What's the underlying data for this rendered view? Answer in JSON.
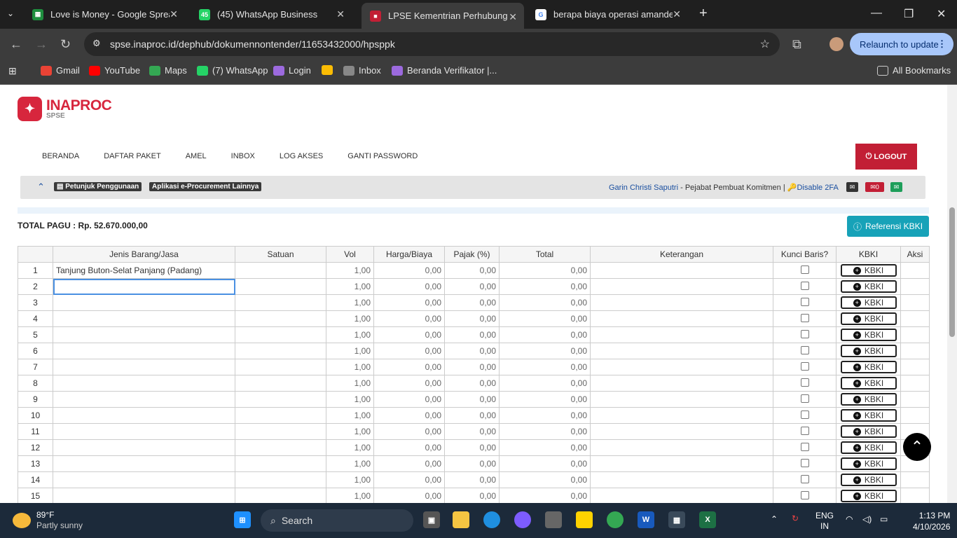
{
  "browser": {
    "tabs": [
      {
        "title": "Love is Money - Google Spread",
        "color": "#1e8e3e",
        "glyph": "▦"
      },
      {
        "title": "(45) WhatsApp Business",
        "color": "#25d366",
        "glyph": "45"
      },
      {
        "title": "LPSE Kementrian Perhubungan",
        "color": "#c21f35",
        "glyph": "■"
      },
      {
        "title": "berapa biaya operasi amandel",
        "color": "#ffffff",
        "glyph": "G"
      }
    ],
    "url": "spse.inaproc.id/dephub/dokumennontender/11653432000/hpsppk",
    "relaunch": "Relaunch to update",
    "bookmarks": [
      {
        "label": "Gmail",
        "color": "#ea4335"
      },
      {
        "label": "YouTube",
        "color": "#ff0000"
      },
      {
        "label": "Maps",
        "color": "#34a853"
      },
      {
        "label": "(7) WhatsApp",
        "color": "#25d366"
      },
      {
        "label": "Login",
        "color": "#9c6ade"
      },
      {
        "label": "",
        "color": "#fbbc04"
      },
      {
        "label": "Inbox",
        "color": "#888888"
      },
      {
        "label": "Beranda Verifikator |...",
        "color": "#9c6ade"
      }
    ],
    "all_bookmarks": "All Bookmarks"
  },
  "site": {
    "brand": "INAPROC",
    "sub": "SPSE",
    "nav": [
      "BERANDA",
      "DAFTAR PAKET",
      "AMEL",
      "INBOX",
      "LOG AKSES",
      "GANTI PASSWORD"
    ],
    "logout": "LOGOUT",
    "guide": "Petunjuk Penggunaan",
    "apps": "Aplikasi e-Procurement Lainnya",
    "user_name": "Garin Christi Saputri",
    "user_role": " - Pejabat Pembuat Komitmen | ",
    "disable_2fa": "Disable 2FA",
    "mail_count": "0",
    "total_pagu": "TOTAL PAGU : Rp. 52.670.000,00",
    "ref_btn": "Referensi KBKI"
  },
  "table": {
    "headers": [
      "",
      "Jenis Barang/Jasa",
      "Satuan",
      "Vol",
      "Harga/Biaya",
      "Pajak (%)",
      "Total",
      "Keterangan",
      "Kunci Baris?",
      "KBKI",
      "Aksi"
    ],
    "kbki_label": "KBKI",
    "rows": [
      {
        "no": "1",
        "jenis": "Tanjung Buton-Selat Panjang (Padang)",
        "vol": "1,00",
        "harga": "0,00",
        "pajak": "0,00",
        "total": "0,00"
      },
      {
        "no": "2",
        "jenis": "",
        "vol": "1,00",
        "harga": "0,00",
        "pajak": "0,00",
        "total": "0,00"
      },
      {
        "no": "3",
        "jenis": "",
        "vol": "1,00",
        "harga": "0,00",
        "pajak": "0,00",
        "total": "0,00"
      },
      {
        "no": "4",
        "jenis": "",
        "vol": "1,00",
        "harga": "0,00",
        "pajak": "0,00",
        "total": "0,00"
      },
      {
        "no": "5",
        "jenis": "",
        "vol": "1,00",
        "harga": "0,00",
        "pajak": "0,00",
        "total": "0,00"
      },
      {
        "no": "6",
        "jenis": "",
        "vol": "1,00",
        "harga": "0,00",
        "pajak": "0,00",
        "total": "0,00"
      },
      {
        "no": "7",
        "jenis": "",
        "vol": "1,00",
        "harga": "0,00",
        "pajak": "0,00",
        "total": "0,00"
      },
      {
        "no": "8",
        "jenis": "",
        "vol": "1,00",
        "harga": "0,00",
        "pajak": "0,00",
        "total": "0,00"
      },
      {
        "no": "9",
        "jenis": "",
        "vol": "1,00",
        "harga": "0,00",
        "pajak": "0,00",
        "total": "0,00"
      },
      {
        "no": "10",
        "jenis": "",
        "vol": "1,00",
        "harga": "0,00",
        "pajak": "0,00",
        "total": "0,00"
      },
      {
        "no": "11",
        "jenis": "",
        "vol": "1,00",
        "harga": "0,00",
        "pajak": "0,00",
        "total": "0,00"
      },
      {
        "no": "12",
        "jenis": "",
        "vol": "1,00",
        "harga": "0,00",
        "pajak": "0,00",
        "total": "0,00"
      },
      {
        "no": "13",
        "jenis": "",
        "vol": "1,00",
        "harga": "0,00",
        "pajak": "0,00",
        "total": "0,00"
      },
      {
        "no": "14",
        "jenis": "",
        "vol": "1,00",
        "harga": "0,00",
        "pajak": "0,00",
        "total": "0,00"
      },
      {
        "no": "15",
        "jenis": "",
        "vol": "1,00",
        "harga": "0,00",
        "pajak": "0,00",
        "total": "0,00"
      }
    ]
  },
  "taskbar": {
    "temp": "89°F",
    "weather": "Partly sunny",
    "search": "Search",
    "lang1": "ENG",
    "lang2": "IN",
    "time": "1:13 PM",
    "date": "4/10/2026"
  }
}
